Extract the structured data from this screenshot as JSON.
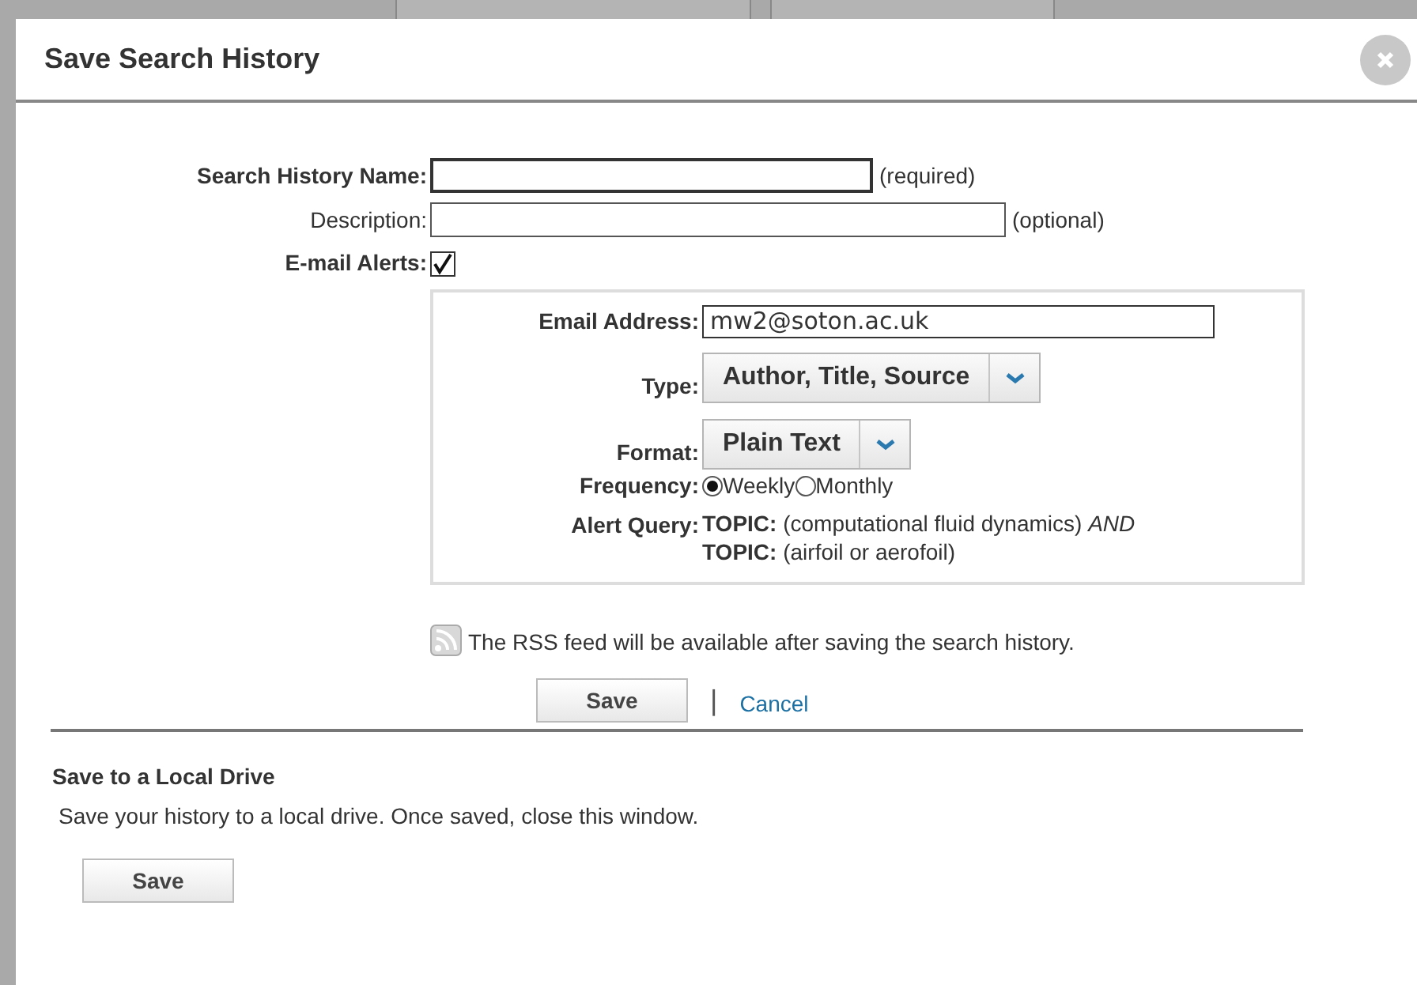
{
  "dialog": {
    "title": "Save Search History"
  },
  "form": {
    "name": {
      "label": "Search History Name:",
      "hint": "(required)"
    },
    "description": {
      "label": "Description:",
      "hint": "(optional)"
    },
    "email_alerts": {
      "label": "E-mail Alerts:",
      "checked": true
    }
  },
  "alert": {
    "email": {
      "label": "Email Address:",
      "value": "mw2@soton.ac.uk"
    },
    "type": {
      "label": "Type:",
      "value": "Author, Title, Source"
    },
    "format": {
      "label": "Format:",
      "value": "Plain Text"
    },
    "frequency": {
      "label": "Frequency:",
      "options": [
        {
          "label": "Weekly",
          "selected": true
        },
        {
          "label": "Monthly",
          "selected": false
        }
      ]
    },
    "query": {
      "label": "Alert Query:",
      "lines": [
        "**TOPIC:** (computational fluid dynamics) *AND*",
        "**TOPIC:** (airfoil or aerofoil)"
      ]
    }
  },
  "rss_note": "The RSS feed will be available after saving the search history.",
  "actions": {
    "save": "Save",
    "separator": "|",
    "cancel": "Cancel"
  },
  "local": {
    "title": "Save to a Local Drive",
    "text": "Save your history to a local drive. Once saved, close this window.",
    "save": "Save"
  }
}
